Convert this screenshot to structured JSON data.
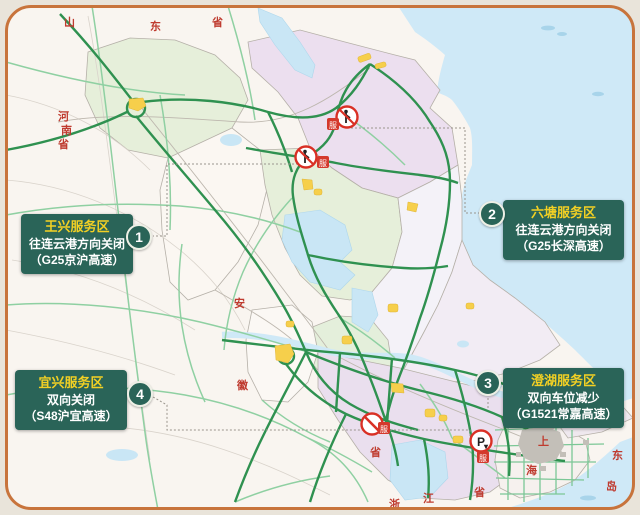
{
  "callouts": [
    {
      "number": "1",
      "title": "王兴服务区",
      "status": "往连云港方向关闭",
      "road": "（G25京沪高速）"
    },
    {
      "number": "2",
      "title": "六塘服务区",
      "status": "往连云港方向关闭",
      "road": "（G25长深高速）"
    },
    {
      "number": "3",
      "title": "澄湖服务区",
      "status": "双向车位减少",
      "road": "（G1521常嘉高速）"
    },
    {
      "number": "4",
      "title": "宜兴服务区",
      "status": "双向关闭",
      "road": "（S48沪宜高速）"
    }
  ],
  "map": {
    "province_labels": [
      {
        "id": "shandong-shan",
        "text": "山"
      },
      {
        "id": "shandong-dong",
        "text": "东"
      },
      {
        "id": "shandong-sheng",
        "text": "省"
      },
      {
        "id": "henan-he",
        "text": "河"
      },
      {
        "id": "henan-nan",
        "text": "南"
      },
      {
        "id": "henan-sheng",
        "text": "省"
      },
      {
        "id": "anhui-an",
        "text": "安"
      },
      {
        "id": "anhui-hui",
        "text": "徽"
      },
      {
        "id": "anhui-sheng",
        "text": "省"
      },
      {
        "id": "zhejiang-zhe",
        "text": "浙"
      },
      {
        "id": "zhejiang-jiang",
        "text": "江"
      },
      {
        "id": "zhejiang-sheng",
        "text": "省"
      },
      {
        "id": "shanghai-shang",
        "text": "上"
      },
      {
        "id": "shanghai-hai",
        "text": "海"
      },
      {
        "id": "sea-dong",
        "text": "东"
      },
      {
        "id": "island-dao",
        "text": "岛"
      }
    ],
    "icons": {
      "service_marker_glyph": "服",
      "parking_glyph": "P",
      "parking_arrow_glyph": "▾"
    },
    "colors": {
      "frame_orange": "#c8743c",
      "callout_green": "#2a6458",
      "callout_title_yellow": "#f2d024",
      "highway_dark_green": "#2f9150",
      "highway_light_green": "#8fd0a2",
      "water_blue": "#c9e6f5",
      "city_yellow": "#f6cf4b",
      "warning_red": "#d93025",
      "label_red": "#bf3b2f"
    }
  }
}
